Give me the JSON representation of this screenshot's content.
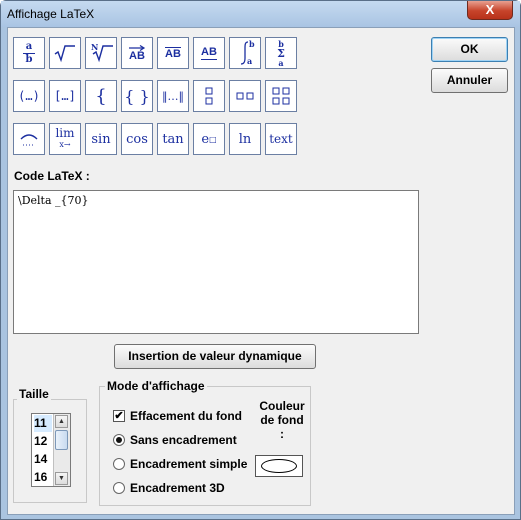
{
  "window": {
    "title": "Affichage LaTeX",
    "close_label": "X"
  },
  "buttons": {
    "ok": "OK",
    "cancel": "Annuler",
    "insert": "Insertion de valeur dynamique"
  },
  "labels": {
    "code": "Code LaTeX :"
  },
  "code": {
    "value": "\\Delta _{70}"
  },
  "toolbar": {
    "fraction_a": "a",
    "fraction_b": "b",
    "sqrt": "√",
    "nroot_n": "N",
    "nroot_radical": "√",
    "vector_text": "AB",
    "segment_text": "AB",
    "underline_text": "AB",
    "integral_b": "b",
    "integral_a": "a",
    "sum_b": "b",
    "sum_a": "a",
    "paren": "(…)",
    "bracket": "[…]",
    "brace_open": "{",
    "braces": "{ }",
    "norm": "‖…‖",
    "overline_sym": "⁀",
    "lim": "lim",
    "lim_sub": "x→",
    "sin": "sin",
    "cos": "cos",
    "tan": "tan",
    "exp": "e",
    "ln": "ln",
    "text": "text"
  },
  "size_group": {
    "title": "Taille",
    "items": [
      "11",
      "12",
      "14",
      "16"
    ],
    "selected": "11"
  },
  "mode_group": {
    "title": "Mode d'affichage",
    "erase_bg": "Effacement du fond",
    "no_frame": "Sans encadrement",
    "simple_frame": "Encadrement simple",
    "frame_3d": "Encadrement 3D",
    "bg_color_line1": "Couleur",
    "bg_color_line2": "de fond :",
    "selected_mode": "Sans encadrement",
    "erase_checked": true
  }
}
